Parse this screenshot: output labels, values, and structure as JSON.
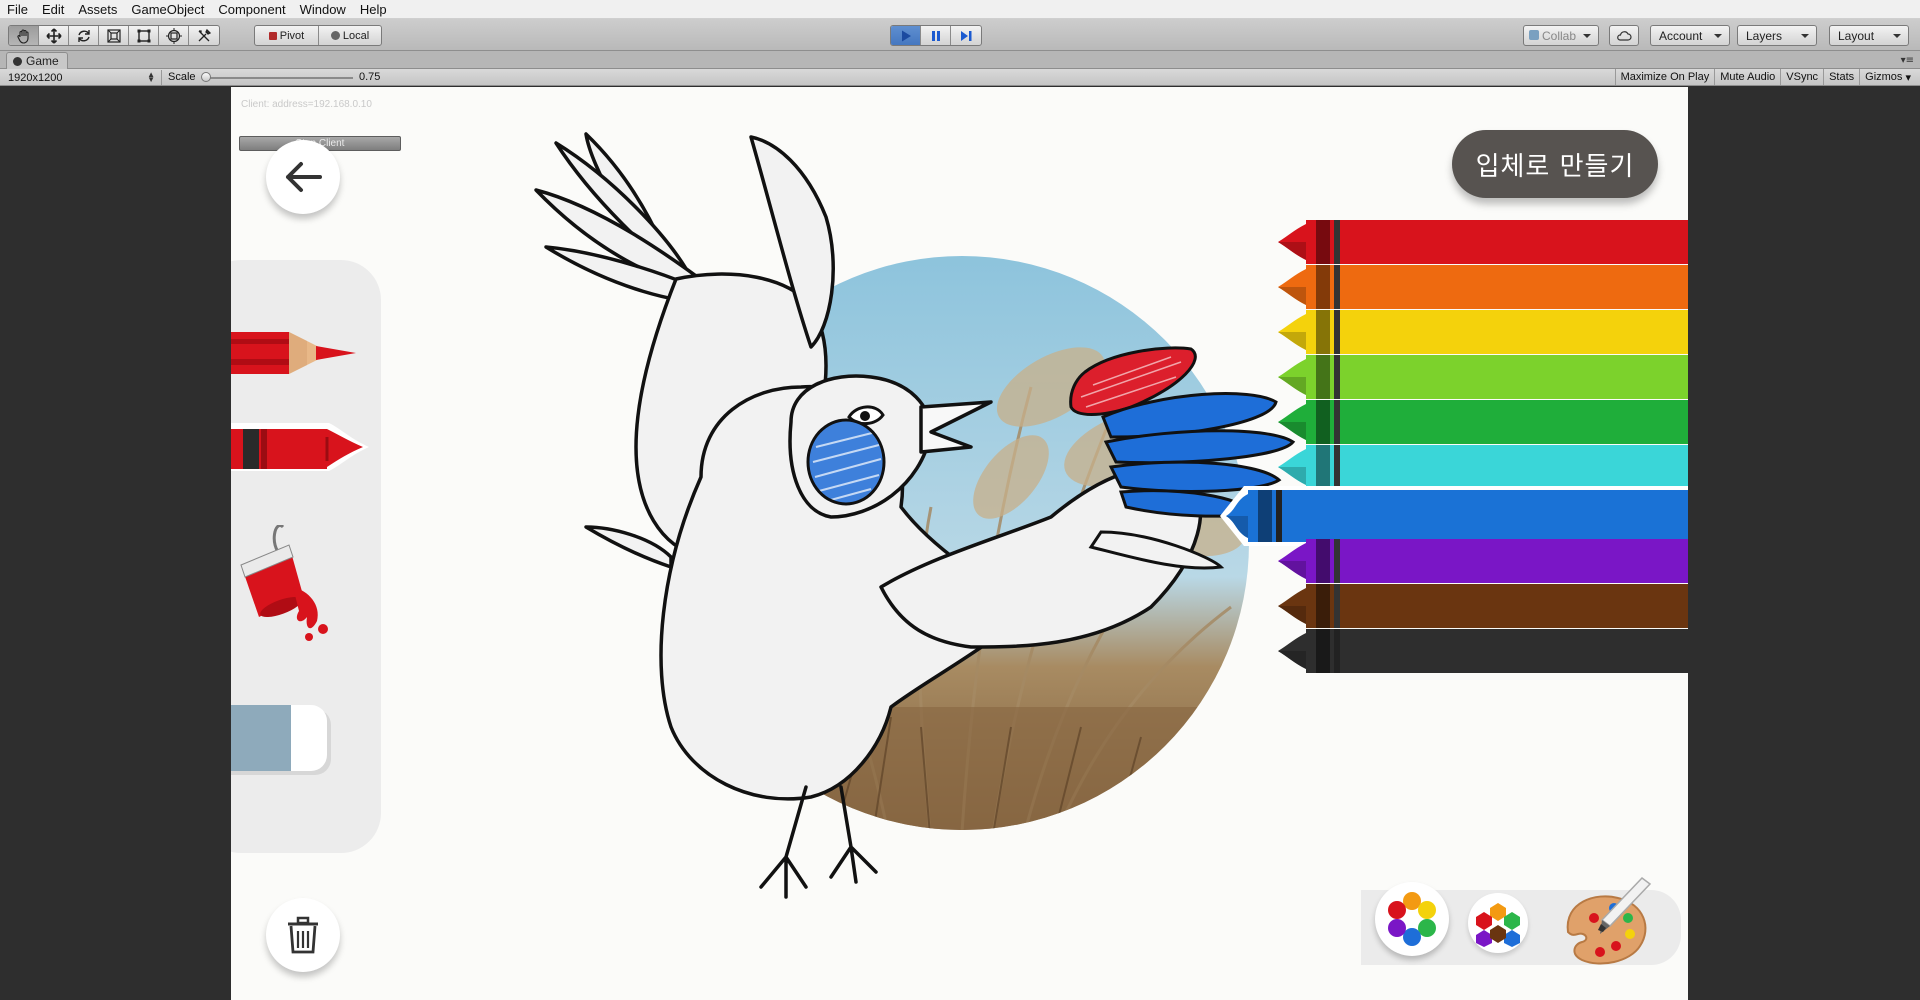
{
  "menu": [
    "File",
    "Edit",
    "Assets",
    "GameObject",
    "Component",
    "Window",
    "Help"
  ],
  "toolbar": {
    "pivot_label": "Pivot",
    "local_label": "Local",
    "collab_label": "Collab",
    "account_label": "Account",
    "layers_label": "Layers",
    "layout_label": "Layout"
  },
  "tab": {
    "title": "Game"
  },
  "gamebar": {
    "resolution": "1920x1200",
    "scale_label": "Scale",
    "scale_value": "0.75",
    "maximize": "Maximize On Play",
    "mute": "Mute Audio",
    "vsync": "VSync",
    "stats": "Stats",
    "gizmos": "Gizmos"
  },
  "game": {
    "debug_ip": "Client: address=192.168.0.10",
    "stop_client": "Stop Client",
    "make3d_label": "입체로 만들기",
    "crayon_colors": [
      "#d8131c",
      "#ee6a10",
      "#f4d20c",
      "#7cd22c",
      "#1fae3a",
      "#3ad6d8",
      "#1a72d6",
      "#7a16c6",
      "#6a3510",
      "#2e2e2e"
    ],
    "selected_crayon": 6,
    "paint_red": "#e01010",
    "paint_blue": "#2a73d8"
  }
}
